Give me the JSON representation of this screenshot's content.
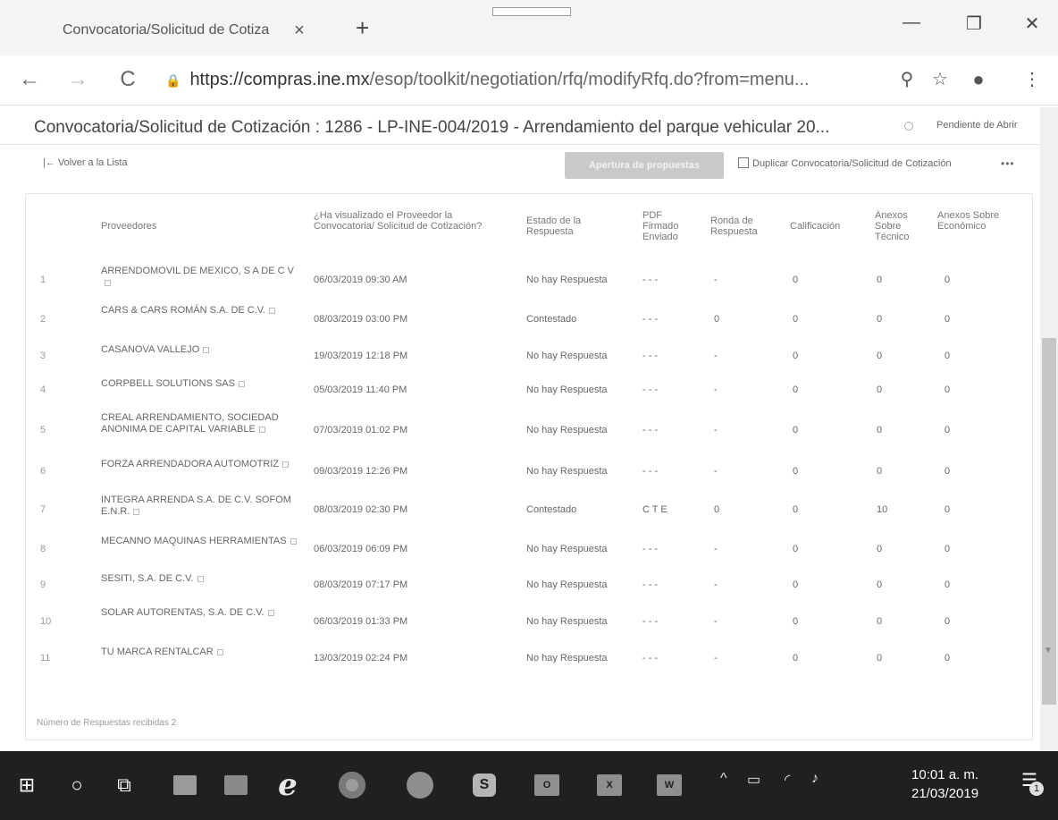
{
  "browser": {
    "tab_title": "Convocatoria/Solicitud de Cotiza",
    "tab_close": "×",
    "new_tab": "+",
    "url_host": "https://compras.ine.mx",
    "url_path": "/esop/toolkit/negotiation/rfq/modifyRfq.do?from=menu...",
    "icons": {
      "back": "←",
      "forward": "→",
      "reload": "C",
      "lock": "🔒",
      "zoom": "⚲",
      "star": "☆",
      "profile": "●",
      "menu": "⋮",
      "minimize": "—",
      "maximize": "❐",
      "close": "✕"
    }
  },
  "page": {
    "title": "Convocatoria/Solicitud de Cotización : 1286 - LP-INE-004/2019 - Arrendamiento del parque vehicular 20...",
    "status": "Pendiente de Abrir",
    "back_link": "|← Volver a la Lista",
    "primary_button": "Apertura de propuestas",
    "duplicate_link": "Duplicar Convocatoria/Solicitud de Cotización",
    "more": "•••",
    "footer_note": "Número de Respuestas recibidas 2"
  },
  "table": {
    "headers": {
      "proveedores": "Proveedores",
      "visualizado": "¿Ha visualizado el Proveedor la Convocatoria/ Solicitud de Cotización?",
      "estado": "Estado de la Respuesta",
      "pdf": "PDF Firmado Enviado",
      "ronda": "Ronda de Respuesta",
      "calificacion": "Calificación",
      "tecnico": "Anexos Sobre Técnico",
      "economico": "Anexos Sobre Económico"
    },
    "rows": [
      {
        "num": "1",
        "proveedor": "ARRENDOMOVIL DE MEXICO, S A DE C V",
        "fecha": "06/03/2019 09:30 AM",
        "estado": "No hay Respuesta",
        "pdf": "- - -",
        "ronda": "-",
        "calificacion": "0",
        "tecnico": "0",
        "economico": "0"
      },
      {
        "num": "2",
        "proveedor": "CARS & CARS ROMÁN S.A. DE C.V.",
        "fecha": "08/03/2019 03:00 PM",
        "estado": "Contestado",
        "pdf": "- - -",
        "ronda": "0",
        "calificacion": "0",
        "tecnico": "0",
        "economico": "0"
      },
      {
        "num": "3",
        "proveedor": "CASANOVA VALLEJO",
        "fecha": "19/03/2019 12:18 PM",
        "estado": "No hay Respuesta",
        "pdf": "- - -",
        "ronda": "-",
        "calificacion": "0",
        "tecnico": "0",
        "economico": "0"
      },
      {
        "num": "4",
        "proveedor": "CORPBELL SOLUTIONS SAS",
        "fecha": "05/03/2019 11:40 PM",
        "estado": "No hay Respuesta",
        "pdf": "- - -",
        "ronda": "-",
        "calificacion": "0",
        "tecnico": "0",
        "economico": "0"
      },
      {
        "num": "5",
        "proveedor": "CREAL ARRENDAMIENTO, SOCIEDAD ANONIMA DE CAPITAL VARIABLE",
        "fecha": "07/03/2019 01:02 PM",
        "estado": "No hay Respuesta",
        "pdf": "- - -",
        "ronda": "-",
        "calificacion": "0",
        "tecnico": "0",
        "economico": "0"
      },
      {
        "num": "6",
        "proveedor": "FORZA ARRENDADORA AUTOMOTRIZ",
        "fecha": "09/03/2019 12:26 PM",
        "estado": "No hay Respuesta",
        "pdf": "- - -",
        "ronda": "-",
        "calificacion": "0",
        "tecnico": "0",
        "economico": "0"
      },
      {
        "num": "7",
        "proveedor": "INTEGRA ARRENDA S.A. DE C.V. SOFOM E.N.R.",
        "fecha": "08/03/2019 02:30 PM",
        "estado": "Contestado",
        "pdf": "C T E",
        "ronda": "0",
        "calificacion": "0",
        "tecnico": "10",
        "economico": "0"
      },
      {
        "num": "8",
        "proveedor": "MECANNO MAQUINAS HERRAMIENTAS",
        "fecha": "06/03/2019 06:09 PM",
        "estado": "No hay Respuesta",
        "pdf": "- - -",
        "ronda": "-",
        "calificacion": "0",
        "tecnico": "0",
        "economico": "0"
      },
      {
        "num": "9",
        "proveedor": "SESITI, S.A. DE C.V.",
        "fecha": "08/03/2019 07:17 PM",
        "estado": "No hay Respuesta",
        "pdf": "- - -",
        "ronda": "-",
        "calificacion": "0",
        "tecnico": "0",
        "economico": "0"
      },
      {
        "num": "10",
        "proveedor": "SOLAR AUTORENTAS, S.A. DE C.V.",
        "fecha": "06/03/2019 01:33 PM",
        "estado": "No hay Respuesta",
        "pdf": "- - -",
        "ronda": "-",
        "calificacion": "0",
        "tecnico": "0",
        "economico": "0"
      },
      {
        "num": "11",
        "proveedor": "TU MARCA RENTALCAR",
        "fecha": "13/03/2019 02:24 PM",
        "estado": "No hay Respuesta",
        "pdf": "- - -",
        "ronda": "-",
        "calificacion": "0",
        "tecnico": "0",
        "economico": "0"
      }
    ]
  },
  "taskbar": {
    "time": "10:01 a. m.",
    "date": "21/03/2019",
    "notification_count": "1",
    "labels": {
      "start": "⊞",
      "search": "○",
      "task_view": "⧉",
      "ie": "e",
      "skype": "S",
      "outlook": "O",
      "excel": "X",
      "word": "W",
      "chevron": "^",
      "network": "▭",
      "wifi": "◜",
      "volume": "♪",
      "notification": "☰"
    }
  }
}
